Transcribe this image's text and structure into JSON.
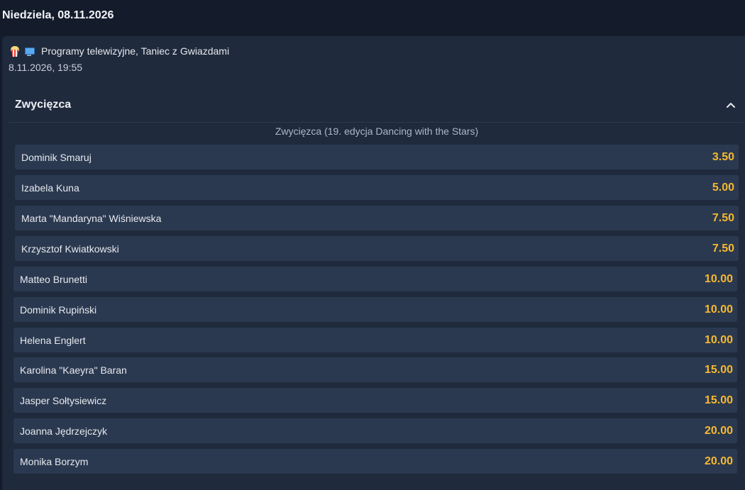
{
  "day_header": "Niedziela, 08.11.2026",
  "event": {
    "icons": [
      "popcorn-icon",
      "tv-icon"
    ],
    "category": "Programy telewizyjne, Taniec z Gwiazdami",
    "datetime": "8.11.2026, 19:55"
  },
  "market": {
    "title": "Zwycięzca",
    "subtitle": "Zwycięzca (19. edycja Dancing with the Stars)",
    "collapse_icon": "chevron-up-icon",
    "odds_color": "#f5b92e",
    "selections": [
      {
        "name": "Dominik Smaruj",
        "odd": "3.50"
      },
      {
        "name": "Izabela Kuna",
        "odd": "5.00"
      },
      {
        "name": "Marta \"Mandaryna\" Wiśniewska",
        "odd": "7.50"
      },
      {
        "name": "Krzysztof Kwiatkowski",
        "odd": "7.50"
      },
      {
        "name": "Matteo Brunetti",
        "odd": "10.00"
      },
      {
        "name": "Dominik Rupiński",
        "odd": "10.00"
      },
      {
        "name": "Helena Englert",
        "odd": "10.00"
      },
      {
        "name": "Karolina \"Kaeyra\" Baran",
        "odd": "15.00"
      },
      {
        "name": "Jasper Sołtysiewicz",
        "odd": "15.00"
      },
      {
        "name": "Joanna Jędrzejczyk",
        "odd": "20.00"
      },
      {
        "name": "Monika Borzym",
        "odd": "20.00"
      }
    ]
  }
}
